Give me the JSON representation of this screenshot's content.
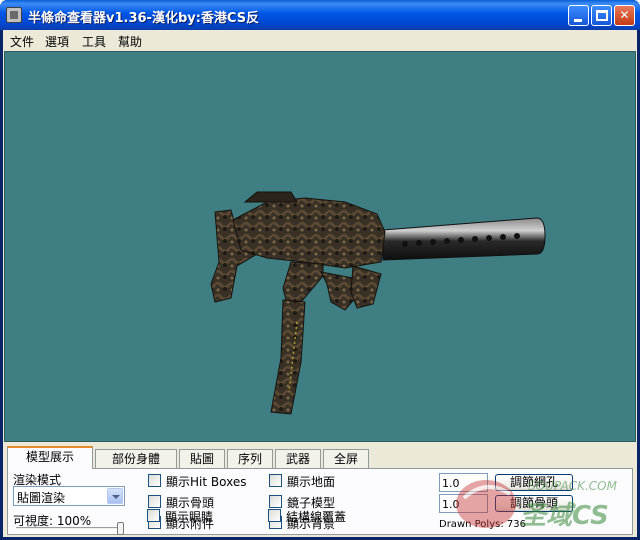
{
  "window": {
    "title": "半條命查看器v1.36-漢化by:香港CS反",
    "controls": [
      "minimize",
      "maximize",
      "close"
    ]
  },
  "menu": {
    "items": [
      "文件",
      "選項",
      "工具",
      "幫助"
    ]
  },
  "viewport": {
    "background": "#3f7e82",
    "model": "submachine gun with silencer (camo texture)"
  },
  "tabs": [
    "模型展示",
    "部份身體",
    "貼圖",
    "序列",
    "武器",
    "全屏"
  ],
  "active_tab": "模型展示",
  "render": {
    "mode_label": "渲染模式",
    "mode_value": "貼圖渲染",
    "visibility_label": "可視度: 100%",
    "visibility_level": 1.0
  },
  "checkboxes": {
    "col1": [
      {
        "label": "顯示Hit Boxes",
        "checked": false
      },
      {
        "label": "顯示骨頭",
        "checked": false
      },
      {
        "label": "顯示附件",
        "checked": false
      },
      {
        "label": "顯示眼睛",
        "checked": false
      }
    ],
    "col2": [
      {
        "label": "顯示地面",
        "checked": false
      },
      {
        "label": "鏡子模型",
        "checked": false
      },
      {
        "label": "顯示背景",
        "checked": false
      },
      {
        "label": "結構線覆蓋",
        "checked": false
      }
    ]
  },
  "adjust": {
    "mesh_value": "1.0",
    "mesh_button": "調節網孔",
    "bone_value": "1.0",
    "bone_button": "調節骨頭"
  },
  "stats": {
    "drawn_polys": "Drawn Polys: 736"
  },
  "watermark": {
    "site": "SOUPACK.COM",
    "logo": "圣域CS"
  }
}
